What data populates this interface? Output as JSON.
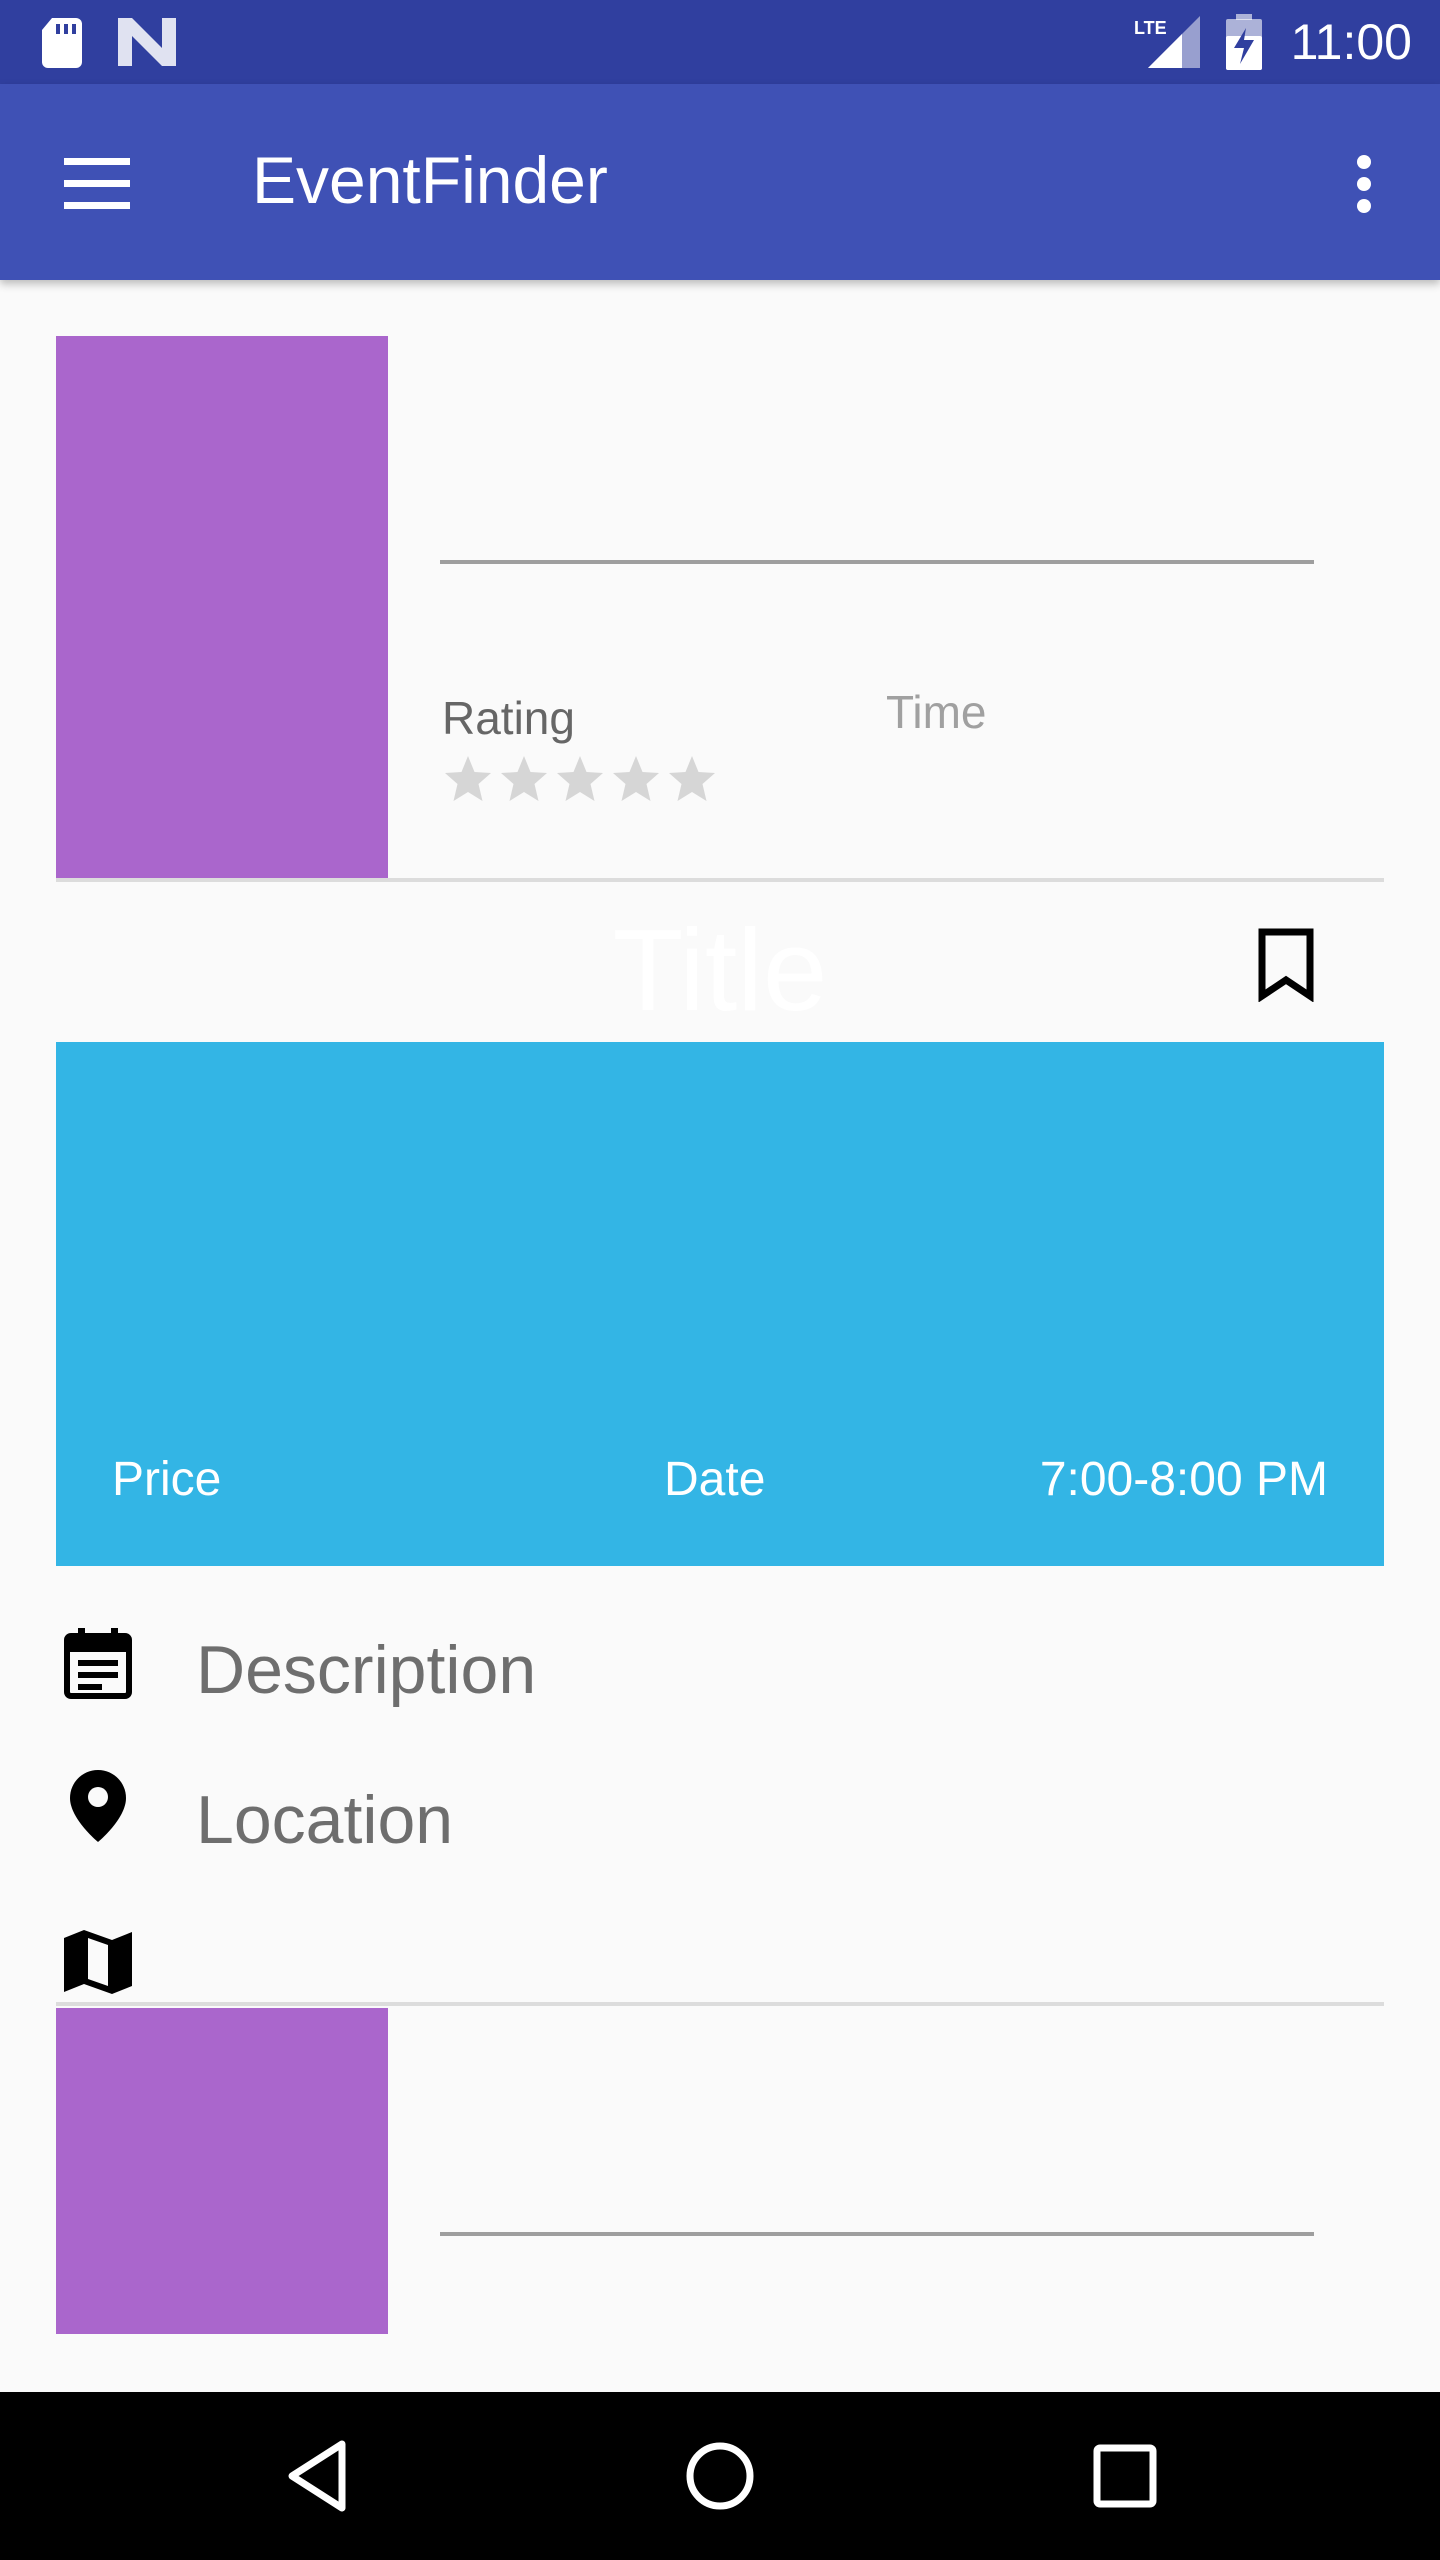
{
  "status_bar": {
    "time": "11:00",
    "icons": [
      "sd-card-icon",
      "n-logo-icon",
      "lte-signal-icon",
      "battery-charging-icon"
    ]
  },
  "app_bar": {
    "title": "EventFinder",
    "menu_icon": "hamburger-menu-icon",
    "overflow_icon": "more-vert-icon"
  },
  "event_card": {
    "rating_label": "Rating",
    "time_label": "Time",
    "rating_stars": 0,
    "rating_max": 5
  },
  "detail": {
    "title": "Title",
    "bookmark_icon": "bookmark-border-icon",
    "price": "Price",
    "date": "Date",
    "time_range": "7:00-8:00 PM"
  },
  "info": {
    "description": "Description",
    "location": "Location"
  },
  "nav_bar": {
    "icons": [
      "back-icon",
      "home-icon",
      "recents-icon"
    ]
  },
  "colors": {
    "status_bar": "#303f9f",
    "app_bar": "#3f51b5",
    "purple": "#aa66cc",
    "blue": "#33b5e5"
  }
}
